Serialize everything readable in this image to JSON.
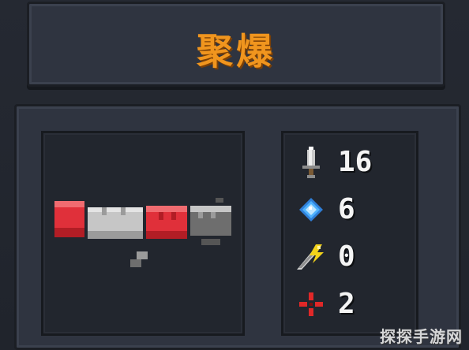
{
  "weapon": {
    "name": "聚爆",
    "name_color": "#f0951e"
  },
  "stats": [
    {
      "name": "damage",
      "icon": "sword-icon",
      "value": "16",
      "icon_color": "#c9c9c9"
    },
    {
      "name": "energy",
      "icon": "blue-crystal-icon",
      "value": "6",
      "icon_color": "#4fb3ff"
    },
    {
      "name": "crit",
      "icon": "knife-lightning-icon",
      "value": "0",
      "icon_color": "#f2d21b"
    },
    {
      "name": "spread",
      "icon": "red-crosshair-icon",
      "value": "2",
      "icon_color": "#e02828"
    }
  ],
  "weapon_sprite": {
    "icon": "explosive-launcher-icon",
    "colors": {
      "red": "#e0303a",
      "gray": "#c6c6c6",
      "dark": "#6e6e6e"
    }
  },
  "watermark": "探探手游网"
}
